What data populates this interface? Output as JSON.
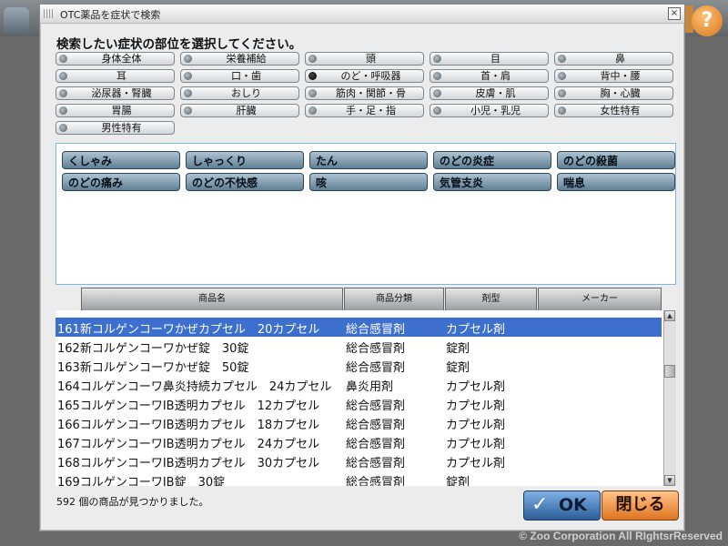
{
  "dialog": {
    "title": "OTC薬品を症状で検索",
    "close_glyph": "×",
    "heading": "検索したい症状の部位を選択してください。"
  },
  "body_parts": [
    {
      "label": "身体全体",
      "selected": false
    },
    {
      "label": "栄養補給",
      "selected": false
    },
    {
      "label": "頭",
      "selected": false
    },
    {
      "label": "目",
      "selected": false
    },
    {
      "label": "鼻",
      "selected": false
    },
    {
      "label": "耳",
      "selected": false
    },
    {
      "label": "口・歯",
      "selected": false
    },
    {
      "label": "のど・呼吸器",
      "selected": true
    },
    {
      "label": "首・肩",
      "selected": false
    },
    {
      "label": "背中・腰",
      "selected": false
    },
    {
      "label": "泌尿器・腎臓",
      "selected": false
    },
    {
      "label": "おしり",
      "selected": false
    },
    {
      "label": "筋肉・関節・骨",
      "selected": false
    },
    {
      "label": "皮膚・肌",
      "selected": false
    },
    {
      "label": "胸・心臓",
      "selected": false
    },
    {
      "label": "胃腸",
      "selected": false
    },
    {
      "label": "肝臓",
      "selected": false
    },
    {
      "label": "手・足・指",
      "selected": false
    },
    {
      "label": "小児・乳児",
      "selected": false
    },
    {
      "label": "女性特有",
      "selected": false
    },
    {
      "label": "男性特有",
      "selected": false
    }
  ],
  "symptoms": [
    "くしゃみ",
    "しゃっくり",
    "たん",
    "のどの炎症",
    "のどの殺菌",
    "のどの痛み",
    "のどの不快感",
    "咳",
    "気管支炎",
    "喘息"
  ],
  "table": {
    "headers": [
      "商品名",
      "商品分類",
      "剤型",
      "メーカー"
    ],
    "rows": [
      {
        "name": "161新コルゲンコーワかぜカプセル　20カプセル",
        "category": "総合感冒剤",
        "form": "カプセル剤",
        "maker": "",
        "selected": true
      },
      {
        "name": "162新コルゲンコーワかぜ錠　30錠",
        "category": "総合感冒剤",
        "form": "錠剤",
        "maker": "",
        "selected": false
      },
      {
        "name": "163新コルゲンコーワかぜ錠　50錠",
        "category": "総合感冒剤",
        "form": "錠剤",
        "maker": "",
        "selected": false
      },
      {
        "name": "164コルゲンコーワ鼻炎持続カプセル　24カプセル",
        "category": "鼻炎用剤",
        "form": "カプセル剤",
        "maker": "",
        "selected": false
      },
      {
        "name": "165コルゲンコーワIB透明カプセル　12カプセル",
        "category": "総合感冒剤",
        "form": "カプセル剤",
        "maker": "",
        "selected": false
      },
      {
        "name": "166コルゲンコーワIB透明カプセル　18カプセル",
        "category": "総合感冒剤",
        "form": "カプセル剤",
        "maker": "",
        "selected": false
      },
      {
        "name": "167コルゲンコーワIB透明カプセル　24カプセル",
        "category": "総合感冒剤",
        "form": "カプセル剤",
        "maker": "",
        "selected": false
      },
      {
        "name": "168コルゲンコーワIB透明カプセル　30カプセル",
        "category": "総合感冒剤",
        "form": "カプセル剤",
        "maker": "",
        "selected": false
      },
      {
        "name": "169コルゲンコーワIB錠　30錠",
        "category": "総合感冒剤",
        "form": "錠剤",
        "maker": "",
        "selected": false
      }
    ]
  },
  "status_text": "592 個の商品が見つかりました。",
  "buttons": {
    "ok_check": "✓",
    "ok_label": "OK",
    "close_label": "閉じる"
  },
  "scrollbar": {
    "up_glyph": "▲",
    "down_glyph": "▼"
  },
  "background": {
    "help_glyph": "?"
  },
  "copyright": "© Zoo Corporation All RIghtsrReserved"
}
